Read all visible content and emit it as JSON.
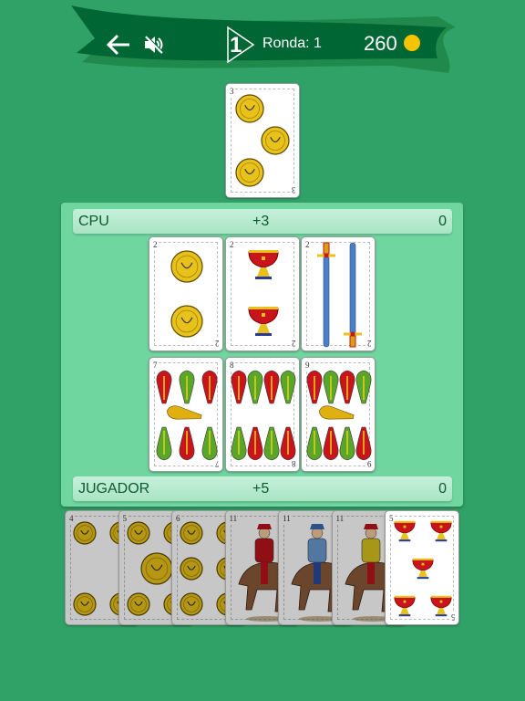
{
  "header": {
    "round_label": "Ronda: 1",
    "round_badge": "1",
    "coins": "260",
    "icons": [
      "back-arrow-icon",
      "sound-muted-icon",
      "round-play-icon",
      "coin-icon"
    ]
  },
  "colors": {
    "background": "#31a267",
    "banner": "#006633",
    "panel": "#70d6a0",
    "coin": "#f5c400"
  },
  "deck_card": {
    "rank": "3",
    "suit": "oros"
  },
  "cpu": {
    "name": "CPU",
    "bonus": "+3",
    "score": "0"
  },
  "player": {
    "name": "JUGADOR",
    "bonus": "+5",
    "score": "0"
  },
  "table_cards": [
    {
      "rank": "2",
      "suit": "oros"
    },
    {
      "rank": "2",
      "suit": "copas"
    },
    {
      "rank": "2",
      "suit": "espadas"
    },
    {
      "rank": "7",
      "suit": "bastos"
    },
    {
      "rank": "8",
      "suit": "bastos"
    },
    {
      "rank": "9",
      "suit": "bastos"
    }
  ],
  "hand": [
    {
      "rank": "4",
      "suit": "oros",
      "dimmed": true
    },
    {
      "rank": "5",
      "suit": "oros",
      "dimmed": true
    },
    {
      "rank": "6",
      "suit": "oros",
      "dimmed": true
    },
    {
      "rank": "11",
      "suit": "copas",
      "dimmed": true
    },
    {
      "rank": "11",
      "suit": "espadas",
      "dimmed": true
    },
    {
      "rank": "11",
      "suit": "oros",
      "dimmed": true
    },
    {
      "rank": "5",
      "suit": "copas",
      "dimmed": false
    }
  ]
}
